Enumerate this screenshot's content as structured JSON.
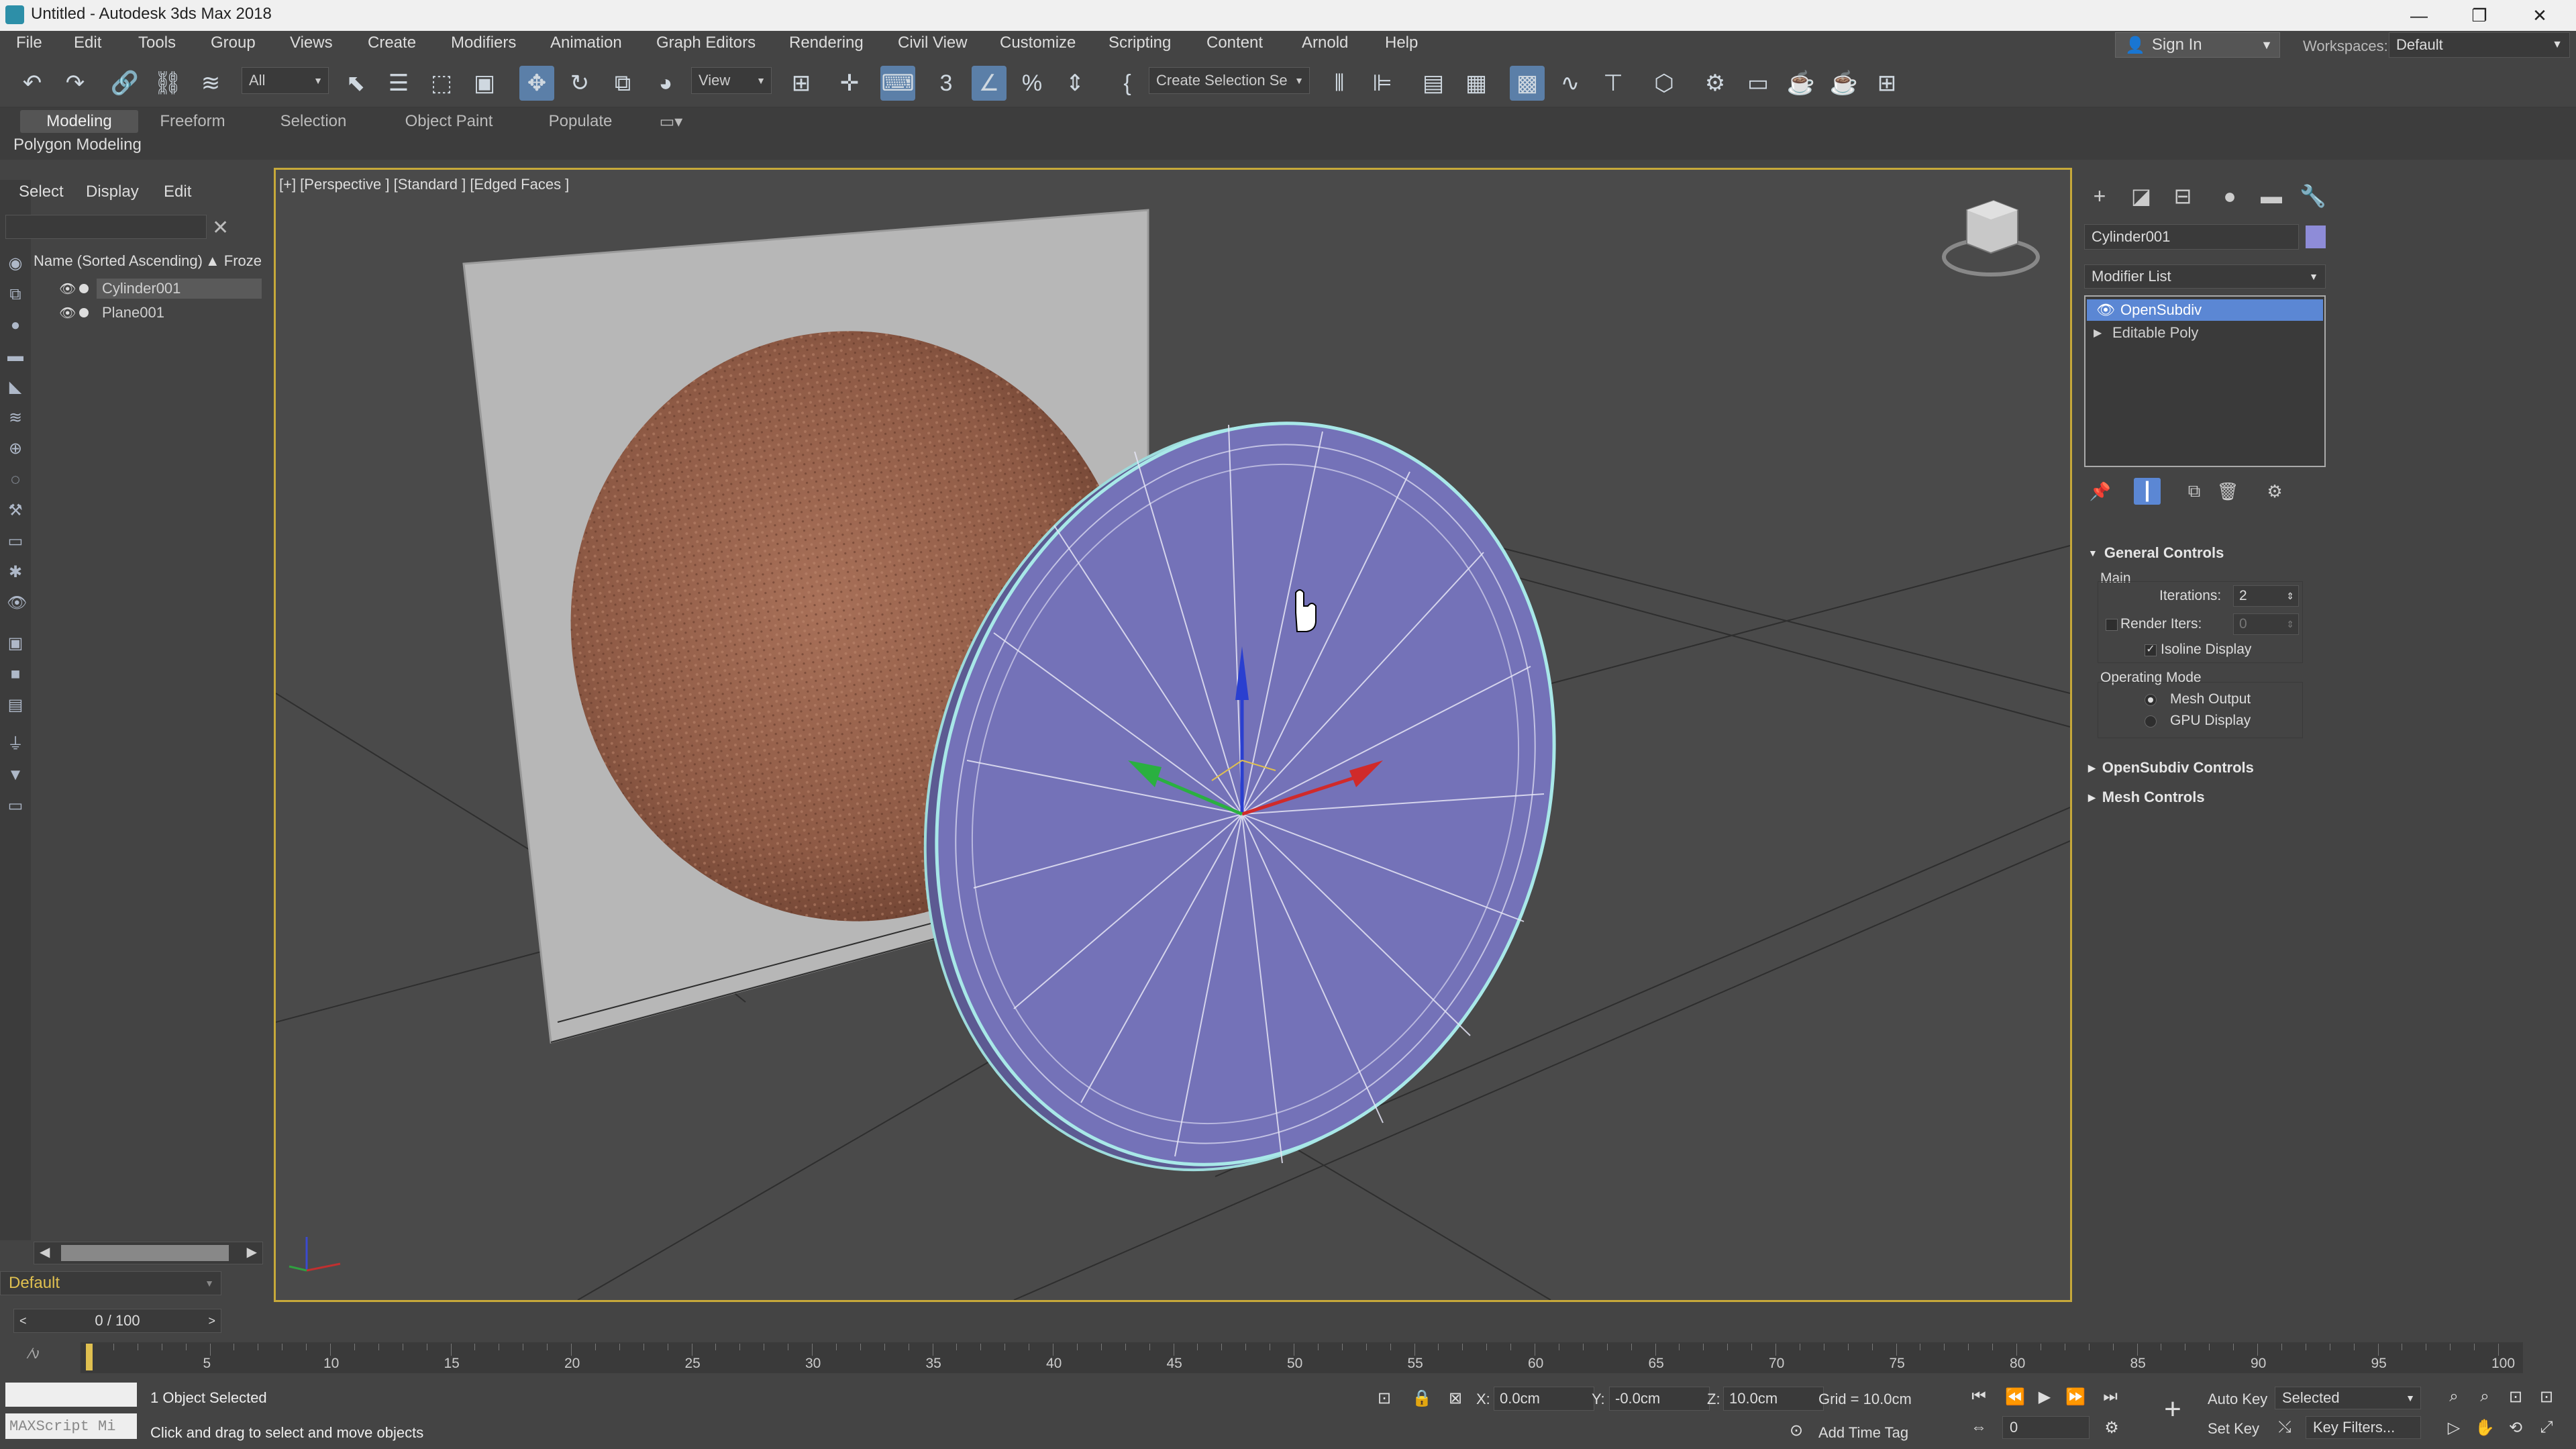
{
  "window": {
    "title": "Untitled - Autodesk 3ds Max 2018",
    "minimize_glyph": "—",
    "restore_glyph": "❐",
    "close_glyph": "✕"
  },
  "menu": [
    "File",
    "Edit",
    "Tools",
    "Group",
    "Views",
    "Create",
    "Modifiers",
    "Animation",
    "Graph Editors",
    "Rendering",
    "Civil View",
    "Customize",
    "Scripting",
    "Content",
    "Arnold",
    "Help"
  ],
  "account": {
    "sign_in": "Sign In",
    "workspaces_label": "Workspaces:",
    "workspace_value": "Default"
  },
  "toolbar": {
    "selection_filter": "All",
    "ref_coord": "View",
    "named_selection": "Create Selection Se"
  },
  "ribbon": {
    "tabs": [
      "Modeling",
      "Freeform",
      "Selection",
      "Object Paint",
      "Populate"
    ],
    "active_tab": "Modeling",
    "panel_label": "Polygon Modeling"
  },
  "scene_explorer": {
    "menu": [
      "Select",
      "Display",
      "Edit"
    ],
    "header_name": "Name (Sorted Ascending)",
    "header_frozen": "▲ Froze",
    "objects": [
      "Cylinder001",
      "Plane001"
    ],
    "layer": "Default"
  },
  "viewport": {
    "label": "[+] [Perspective ] [Standard ] [Edged Faces ]"
  },
  "command_panel": {
    "object_name": "Cylinder001",
    "object_color": "#8e8cd8",
    "modifier_list": "Modifier List",
    "stack": [
      "OpenSubdiv",
      "Editable Poly"
    ],
    "rollouts": {
      "general": "General Controls",
      "main_group": "Main",
      "iterations_label": "Iterations:",
      "iterations_value": "2",
      "render_iters_label": "Render Iters:",
      "render_iters_value": "0",
      "isoline_label": "Isoline Display",
      "operating_mode": "Operating Mode",
      "mesh_output": "Mesh Output",
      "gpu_display": "GPU Display",
      "opensubdiv_controls": "OpenSubdiv Controls",
      "mesh_controls": "Mesh Controls"
    }
  },
  "timeline": {
    "frame_display": "0 / 100",
    "ticks": [
      "5",
      "10",
      "15",
      "20",
      "25",
      "30",
      "35",
      "40",
      "45",
      "50",
      "55",
      "60",
      "65",
      "70",
      "75",
      "80",
      "85",
      "90",
      "95",
      "100"
    ]
  },
  "status": {
    "maxscript": "MAXScript Mi",
    "selection": "1 Object Selected",
    "prompt": "Click and drag to select and move objects",
    "x_label": "X:",
    "x_value": "0.0cm",
    "y_label": "Y:",
    "y_value": "-0.0cm",
    "z_label": "Z:",
    "z_value": "10.0cm",
    "grid": "Grid = 10.0cm",
    "add_time_tag": "Add Time Tag",
    "auto_key": "Auto Key",
    "set_key": "Set Key",
    "key_mode": "Selected",
    "key_filters": "Key Filters...",
    "current_frame": "0"
  },
  "colors": {
    "viewport_border": "#c7a93a",
    "selection": "#5b87d4",
    "layer_text": "#e0c050"
  }
}
